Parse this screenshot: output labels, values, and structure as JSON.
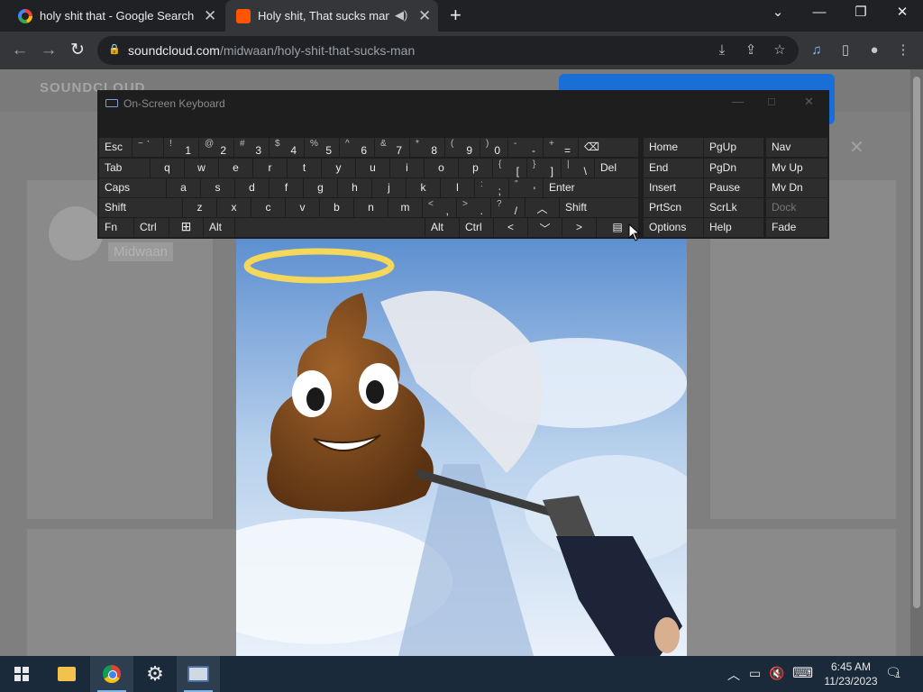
{
  "browser": {
    "tabs": [
      {
        "title": "holy shit that - Google Search",
        "favicon": "google-icon"
      },
      {
        "title": "Holy shit, That sucks man. b",
        "favicon": "soundcloud-icon",
        "active": true
      }
    ],
    "new_tab_icon": "+",
    "address": {
      "domain": "soundcloud.com",
      "path": "/midwaan/holy-shit-that-sucks-man"
    },
    "icons": {
      "back": "←",
      "forward": "→",
      "reload": "↻",
      "lock": "🔒",
      "install": "⤓",
      "share": "⇪",
      "star": "☆",
      "media": "♫",
      "sidepanel": "▯",
      "profile": "●",
      "menu": "⋮"
    },
    "window_controls": {
      "tab_list": "⌄",
      "minimize": "—",
      "restore": "❐",
      "close": "✕"
    }
  },
  "page": {
    "logo": "SOUNDCLOUD",
    "artist": "Midwaan",
    "close": "✕"
  },
  "osk": {
    "title": "On-Screen Keyboard",
    "controls": {
      "minimize": "—",
      "maximize": "□",
      "close": "✕"
    },
    "rows": {
      "row1": {
        "esc": "Esc",
        "tilde": {
          "up": "~",
          "dn": "`"
        },
        "k1": {
          "up": "!",
          "dn": "1"
        },
        "k2": {
          "up": "@",
          "dn": "2"
        },
        "k3": {
          "up": "#",
          "dn": "3"
        },
        "k4": {
          "up": "$",
          "dn": "4"
        },
        "k5": {
          "up": "%",
          "dn": "5"
        },
        "k6": {
          "up": "^",
          "dn": "6"
        },
        "k7": {
          "up": "&",
          "dn": "7"
        },
        "k8": {
          "up": "*",
          "dn": "8"
        },
        "k9": {
          "up": "(",
          "dn": "9"
        },
        "k0": {
          "up": ")",
          "dn": "0"
        },
        "minus": {
          "up": "-",
          "dn": "-"
        },
        "equals": {
          "up": "+",
          "dn": "="
        },
        "backspace": "⌫"
      },
      "row2": {
        "tab": "Tab",
        "letters": [
          "q",
          "w",
          "e",
          "r",
          "t",
          "y",
          "u",
          "i",
          "o",
          "p"
        ],
        "lbracket": {
          "up": "{",
          "dn": "["
        },
        "rbracket": {
          "up": "}",
          "dn": "]"
        },
        "backslash": {
          "up": "|",
          "dn": "\\"
        },
        "del": "Del"
      },
      "row3": {
        "caps": "Caps",
        "letters": [
          "a",
          "s",
          "d",
          "f",
          "g",
          "h",
          "j",
          "k",
          "l"
        ],
        "semicolon": {
          "up": ":",
          "dn": ";"
        },
        "quote": {
          "up": "\"",
          "dn": "'"
        },
        "enter": "Enter"
      },
      "row4": {
        "shift_l": "Shift",
        "letters": [
          "z",
          "x",
          "c",
          "v",
          "b",
          "n",
          "m"
        ],
        "comma": {
          "up": "<",
          "dn": ","
        },
        "period": {
          "up": ">",
          "dn": "."
        },
        "slash": {
          "up": "?",
          "dn": "/"
        },
        "arrow_up": "︿",
        "shift_r": "Shift"
      },
      "row5": {
        "fn": "Fn",
        "ctrl_l": "Ctrl",
        "win": "⊞",
        "alt_l": "Alt",
        "alt_r": "Alt",
        "ctrl_r": "Ctrl",
        "arrow_left": "<",
        "arrow_down": "﹀",
        "arrow_right": ">",
        "menu": "▤"
      }
    },
    "nav_keys": [
      [
        "Home",
        "PgUp",
        "Nav"
      ],
      [
        "End",
        "PgDn",
        "Mv Up"
      ],
      [
        "Insert",
        "Pause",
        "Mv Dn"
      ],
      [
        "PrtScn",
        "ScrLk",
        "Dock"
      ],
      [
        "Options",
        "Help",
        "Fade"
      ]
    ]
  },
  "taskbar": {
    "apps": [
      "start-button",
      "file-explorer",
      "chrome",
      "settings",
      "on-screen-keyboard"
    ],
    "tray": {
      "chevron": "︿",
      "network": "▭",
      "volume": "🔇",
      "keyboard": "⌨"
    },
    "time": "6:45 AM",
    "date": "11/23/2023",
    "notification_count": "1"
  }
}
